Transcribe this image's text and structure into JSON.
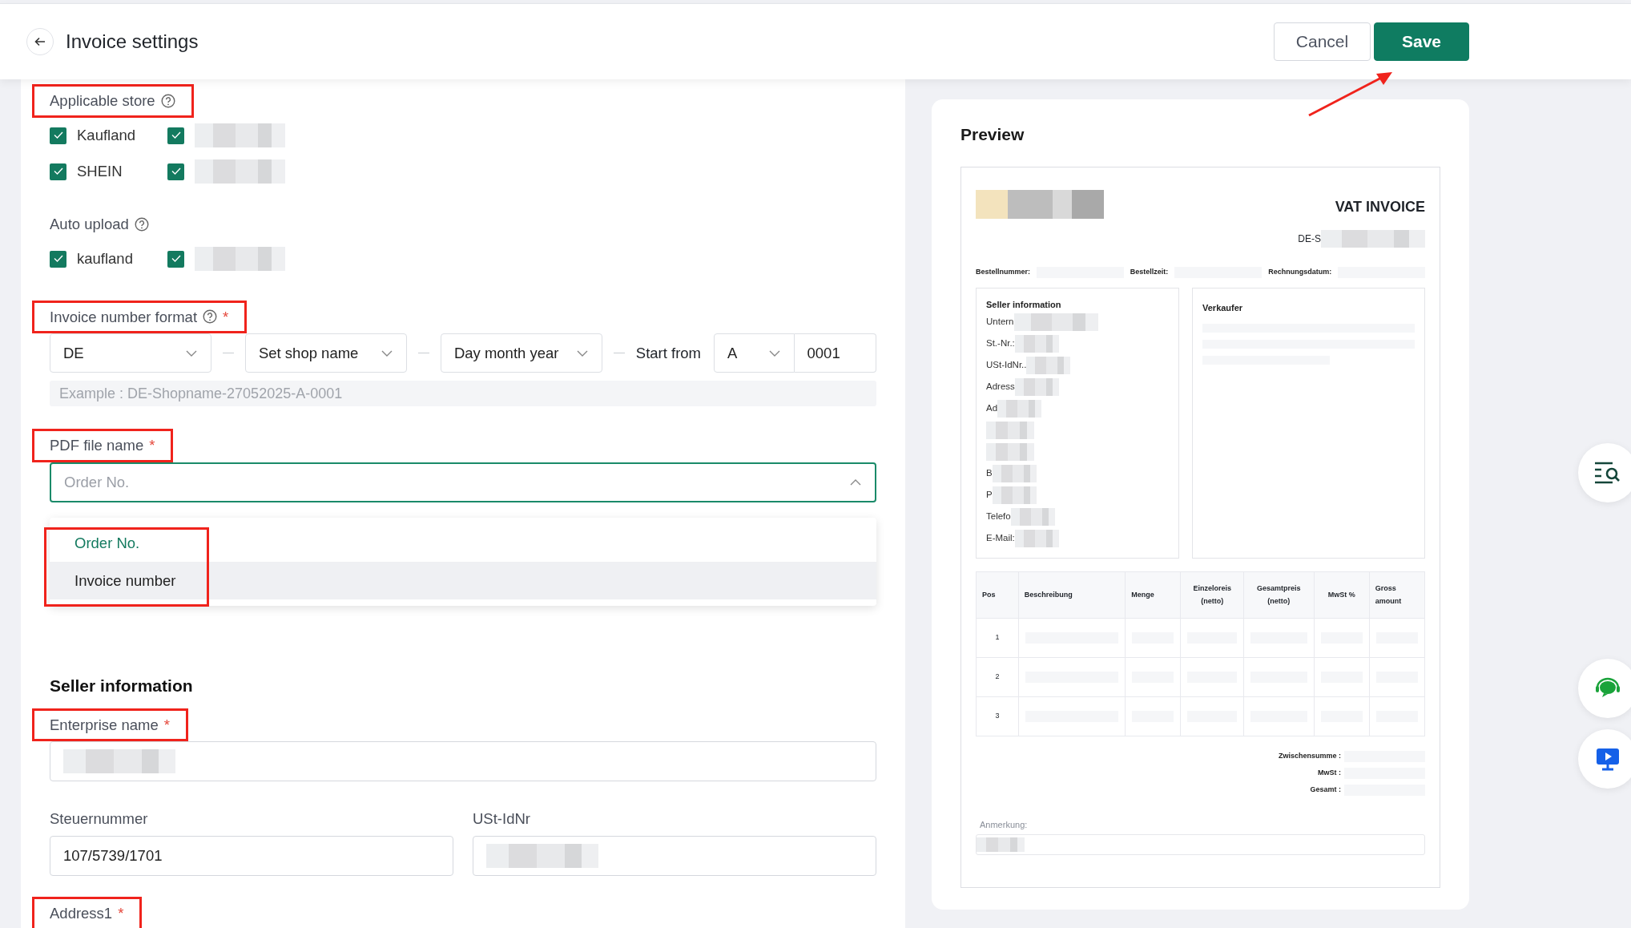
{
  "header": {
    "title": "Invoice settings",
    "annotation_arrow": true,
    "buttons": [
      {
        "label": "Cancel",
        "kind": "secondary"
      },
      {
        "label": "Save",
        "kind": "primary"
      }
    ]
  },
  "form": {
    "applicable_store": {
      "label": "Applicable store",
      "help": true,
      "annotated": true,
      "stores": [
        {
          "label": "Kaufland",
          "checked": true
        },
        {
          "redacted": true,
          "checked": true
        },
        {
          "label": "SHEIN",
          "checked": true
        },
        {
          "redacted": true,
          "checked": true
        }
      ]
    },
    "auto_upload": {
      "label": "Auto upload",
      "help": true,
      "stores": [
        {
          "label": "kaufland",
          "checked": true
        },
        {
          "redacted": true,
          "checked": true
        }
      ]
    },
    "invoice_number_format": {
      "label": "Invoice number format",
      "help": true,
      "required_mark": "*",
      "annotated": true,
      "segments": [
        "DE",
        "Set shop name",
        "Day month year"
      ],
      "start_from": {
        "label": "Start from",
        "prefix": "A",
        "number": "0001"
      },
      "example": "Example : DE-Shopname-27052025-A-0001"
    },
    "pdf_file_name": {
      "label": "PDF file name",
      "required_mark": "*",
      "annotated": true,
      "placeholder": "Order No.",
      "expanded": true,
      "options_annotated": true,
      "options": [
        {
          "label": "Order No.",
          "selected": true,
          "hovered": false
        },
        {
          "label": "Invoice number",
          "selected": false,
          "hovered": true
        }
      ]
    },
    "seller_information": {
      "title": "Seller information",
      "rows": [
        [
          {
            "label": "Enterprise name",
            "required_mark": "*",
            "annotated": true,
            "redacted": true
          }
        ],
        [
          {
            "label": "Steuernummer",
            "value": "107/5739/1701"
          },
          {
            "label": "USt-IdNr",
            "redacted": true
          }
        ],
        [
          {
            "label": "Address1",
            "required_mark": "*",
            "annotated": true
          }
        ]
      ]
    }
  },
  "preview": {
    "title": "Preview",
    "document": {
      "title": "VAT INVOICE",
      "number_prefix": "DE-S",
      "meta": [
        "Bestellnummer:",
        "Bestellzeit:",
        "Rechnungsdatum:"
      ],
      "seller_box": {
        "title": "Seller information",
        "lines": [
          {
            "text": "Untern"
          },
          {
            "text": "St.-Nr.:"
          },
          {
            "text": "USt-IdNr.."
          },
          {
            "text": "Adress"
          },
          {
            "text": "Ad"
          },
          {
            "kind": "blank"
          },
          {
            "kind": "blank"
          },
          {
            "text": "B"
          },
          {
            "text": "P"
          },
          {
            "text": "Telefo"
          },
          {
            "text": "E-Mail:"
          }
        ]
      },
      "buyer_box": {
        "title": "Verkaufer"
      },
      "columns": [
        "Pos",
        "Beschreibung",
        "Menge",
        "Einzeloreis (netto)",
        "Gesamtpreis (netto)",
        "MwSt %",
        "Gross amount"
      ],
      "rows": [
        "1",
        "2",
        "3"
      ],
      "totals": [
        "Zwischensumme :",
        "MwSt :",
        "Gesamt :"
      ],
      "remark": "Anmerkung:"
    }
  },
  "side_tools": [
    {
      "kind": "search"
    },
    {
      "kind": "chat"
    },
    {
      "kind": "video"
    }
  ]
}
